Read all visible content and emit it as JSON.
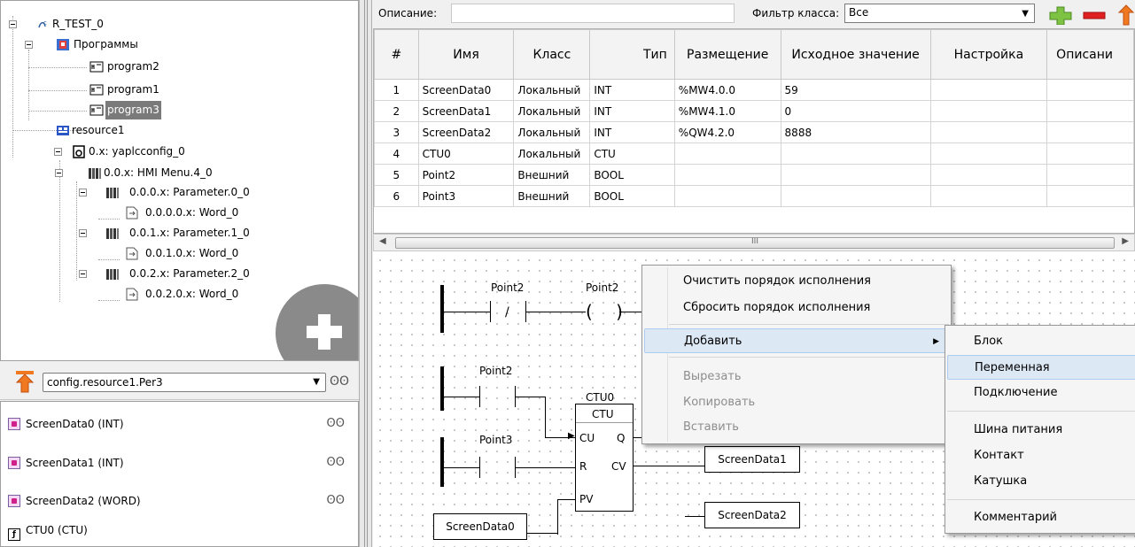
{
  "tree": {
    "project": "R_TEST_0",
    "programs_folder": "Программы",
    "programs": [
      "program2",
      "program1",
      "program3"
    ],
    "selected_program": "program3",
    "resource": "resource1",
    "config": "0.x: yaplcconfig_0",
    "hmi_menu": "0.0.x: HMI Menu.4_0",
    "params": [
      {
        "label": "0.0.0.x: Parameter.0_0",
        "child": "0.0.0.0.x: Word_0"
      },
      {
        "label": "0.0.1.x: Parameter.1_0",
        "child": "0.0.1.0.x: Word_0"
      },
      {
        "label": "0.0.2.x: Parameter.2_0",
        "child": "0.0.2.0.x: Word_0"
      }
    ]
  },
  "debug": {
    "instance": "config.resource1.Per3",
    "vars": [
      "ScreenData0 (INT)",
      "ScreenData1 (INT)",
      "ScreenData2 (WORD)",
      "CTU0 (CTU)"
    ]
  },
  "editor": {
    "description_label": "Описание:",
    "description_value": "",
    "filter_label": "Фильтр класса:",
    "filter_value": "Все"
  },
  "table": {
    "headers": [
      "#",
      "Имя",
      "Класс",
      "Тип",
      "Размещение",
      "Исходное значение",
      "Настройка",
      "Описани"
    ],
    "rows": [
      [
        "1",
        "ScreenData0",
        "Локальный",
        "INT",
        "%MW4.0.0",
        "59",
        "",
        ""
      ],
      [
        "2",
        "ScreenData1",
        "Локальный",
        "INT",
        "%MW4.1.0",
        "0",
        "",
        ""
      ],
      [
        "3",
        "ScreenData2",
        "Локальный",
        "INT",
        "%QW4.2.0",
        "8888",
        "",
        ""
      ],
      [
        "4",
        "CTU0",
        "Локальный",
        "CTU",
        "",
        "",
        "",
        ""
      ],
      [
        "5",
        "Point2",
        "Внешний",
        "BOOL",
        "",
        "",
        "",
        ""
      ],
      [
        "6",
        "Point3",
        "Внешний",
        "BOOL",
        "",
        "",
        "",
        ""
      ]
    ]
  },
  "scroll_marker": "III",
  "ladder": {
    "rung1_contact": "Point2",
    "rung1_coil": "Point2",
    "rung2_contact": "Point2",
    "rung3_contact": "Point3",
    "block_instance": "CTU0",
    "block_type": "CTU",
    "pin_cu": "CU",
    "pin_r": "R",
    "pin_pv": "PV",
    "pin_q": "Q",
    "pin_cv": "CV",
    "in_var": "ScreenData0",
    "out_var1": "ScreenData1",
    "out_var2": "ScreenData2",
    "contact_nc_mark": "/",
    "coil_mark": "( )"
  },
  "context_menu": {
    "items": [
      {
        "label": "Очистить порядок исполнения",
        "enabled": true
      },
      {
        "label": "Сбросить порядок исполнения",
        "enabled": true
      },
      {
        "label": "Добавить",
        "enabled": true,
        "submenu": true
      },
      {
        "label": "Вырезать",
        "enabled": false
      },
      {
        "label": "Копировать",
        "enabled": false
      },
      {
        "label": "Вставить",
        "enabled": false
      }
    ]
  },
  "submenu": {
    "items": [
      "Блок",
      "Переменная",
      "Подключение",
      "Шина питания",
      "Контакт",
      "Катушка",
      "Комментарий"
    ],
    "highlighted": "Переменная"
  },
  "colors": {
    "selection": "#7a7a7a",
    "menu_highlight": "#dde8f5",
    "add_green": "#7dc242",
    "delete_red": "#e02020",
    "up_orange": "#f07820"
  }
}
